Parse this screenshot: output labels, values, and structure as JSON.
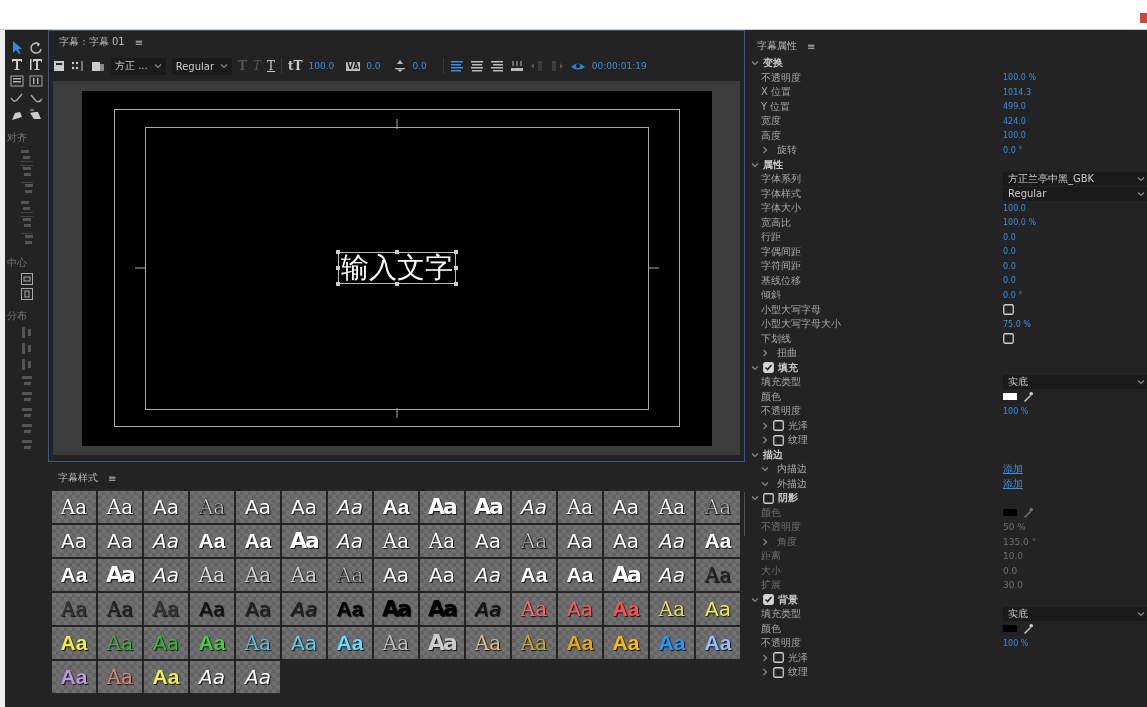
{
  "left_toolbar": {
    "sections": [
      {
        "label": "对齐"
      },
      {
        "label": "中心"
      },
      {
        "label": "分布"
      }
    ]
  },
  "titler": {
    "title": "字幕 : 字幕 01",
    "menu": "≡",
    "toolbar": {
      "font": "方正 ...",
      "style": "Regular",
      "style_buttons": [
        {
          "glyph": "T",
          "disabled": true
        },
        {
          "glyph": "T",
          "disabled": true
        },
        {
          "glyph": "T",
          "disabled": false
        }
      ],
      "size_glyph": "tT",
      "font_size": "100.0",
      "kerning_glyph": "VA",
      "kerning": "0.0",
      "baseline": "0.0",
      "alignments": [
        {
          "selected": true
        },
        {
          "selected": false
        },
        {
          "selected": false
        }
      ],
      "timecode": "00:00:01:19"
    },
    "canvas": {
      "text": "输入文字"
    }
  },
  "styles_panel": {
    "title": "字幕样式",
    "menu": "≡",
    "styles": [
      {
        "text": "Aa",
        "kind": "serif",
        "color": "#ffffff"
      },
      {
        "text": "Aa",
        "kind": "serif",
        "color": "#ffffff"
      },
      {
        "text": "Aa",
        "kind": "sans",
        "color": "#ffffff"
      },
      {
        "text": "Aa",
        "kind": "outline",
        "color": "#dddddd"
      },
      {
        "text": "Aa",
        "kind": "sans",
        "color": "#ffffff"
      },
      {
        "text": "Aa",
        "kind": "sans",
        "color": "#ffffff"
      },
      {
        "text": "Aa",
        "kind": "italic",
        "color": "#ffffff"
      },
      {
        "text": "Aa",
        "kind": "bold",
        "color": "#ffffff"
      },
      {
        "text": "Aa",
        "kind": "heavy",
        "color": "#ffffff"
      },
      {
        "text": "Aa",
        "kind": "heavy",
        "color": "#ffffff"
      },
      {
        "text": "Aa",
        "kind": "italic",
        "color": "#ffffff"
      },
      {
        "text": "Aa",
        "kind": "serif",
        "color": "#ffffff"
      },
      {
        "text": "Aa",
        "kind": "sans",
        "color": "#ffffff"
      },
      {
        "text": "Aa",
        "kind": "serif",
        "color": "#ffffff"
      },
      {
        "text": "Aa",
        "kind": "outline",
        "color": "#dddddd"
      },
      {
        "text": "Aa",
        "kind": "sans",
        "color": "#ffffff"
      },
      {
        "text": "Aa",
        "kind": "sans",
        "color": "#ffffff"
      },
      {
        "text": "Aa",
        "kind": "italic",
        "color": "#ffffff"
      },
      {
        "text": "Aa",
        "kind": "bold",
        "color": "#ffffff"
      },
      {
        "text": "Aa",
        "kind": "bold",
        "color": "#ffffff"
      },
      {
        "text": "Aa",
        "kind": "heavy",
        "color": "#ffffff"
      },
      {
        "text": "Aa",
        "kind": "italic",
        "color": "#ffffff"
      },
      {
        "text": "Aa",
        "kind": "serif",
        "color": "#ffffff"
      },
      {
        "text": "Aa",
        "kind": "serif",
        "color": "#ffffff"
      },
      {
        "text": "Aa",
        "kind": "sans",
        "color": "#ffffff"
      },
      {
        "text": "Aa",
        "kind": "outline",
        "color": "#dddddd"
      },
      {
        "text": "Aa",
        "kind": "sans",
        "color": "#ffffff"
      },
      {
        "text": "Aa",
        "kind": "sans",
        "color": "#ffffff"
      },
      {
        "text": "Aa",
        "kind": "italic",
        "color": "#ffffff"
      },
      {
        "text": "Aa",
        "kind": "bold",
        "color": "#ffffff"
      },
      {
        "text": "Aa",
        "kind": "bold",
        "color": "#ffffff"
      },
      {
        "text": "Aa",
        "kind": "heavy",
        "color": "#ffffff"
      },
      {
        "text": "Aa",
        "kind": "italic",
        "color": "#ffffff"
      },
      {
        "text": "Aa",
        "kind": "serif",
        "color": "#dddddd"
      },
      {
        "text": "Aa",
        "kind": "serif",
        "color": "#cccccc"
      },
      {
        "text": "Aa",
        "kind": "serif",
        "color": "#cccccc"
      },
      {
        "text": "Aa",
        "kind": "outline",
        "color": "#cccccc"
      },
      {
        "text": "Aa",
        "kind": "sans",
        "color": "#ffffff"
      },
      {
        "text": "Aa",
        "kind": "sans",
        "color": "#ffffff"
      },
      {
        "text": "Aa",
        "kind": "italic",
        "color": "#ffffff"
      },
      {
        "text": "Aa",
        "kind": "bold",
        "color": "#ffffff"
      },
      {
        "text": "Aa",
        "kind": "bold",
        "color": "#ffffff"
      },
      {
        "text": "Aa",
        "kind": "heavy",
        "color": "#ffffff"
      },
      {
        "text": "Aa",
        "kind": "italic",
        "color": "#ffffff"
      },
      {
        "text": "Aa",
        "kind": "serif",
        "color": "#222222"
      },
      {
        "text": "Aa",
        "kind": "serif",
        "color": "#333333"
      },
      {
        "text": "Aa",
        "kind": "serif",
        "color": "#222222"
      },
      {
        "text": "Aa",
        "kind": "outline",
        "color": "#333333"
      },
      {
        "text": "Aa",
        "kind": "sans",
        "color": "#111111"
      },
      {
        "text": "Aa",
        "kind": "sans",
        "color": "#222222"
      },
      {
        "text": "Aa",
        "kind": "italic",
        "color": "#222222"
      },
      {
        "text": "Aa",
        "kind": "bold",
        "color": "#000000"
      },
      {
        "text": "Aa",
        "kind": "heavy",
        "color": "#000000"
      },
      {
        "text": "Aa",
        "kind": "heavy",
        "color": "#000000"
      },
      {
        "text": "Aa",
        "kind": "italic",
        "color": "#111111"
      },
      {
        "text": "Aa",
        "kind": "serif",
        "color": "#ff6666"
      },
      {
        "text": "Aa",
        "kind": "sans",
        "color": "#ff5a5a"
      },
      {
        "text": "Aa",
        "kind": "bold",
        "color": "#ff5050"
      },
      {
        "text": "Aa",
        "kind": "serif",
        "color": "#dddd66"
      },
      {
        "text": "Aa",
        "kind": "sans",
        "color": "#eeee55"
      },
      {
        "text": "Aa",
        "kind": "bold",
        "color": "#eeee44"
      },
      {
        "text": "Aa",
        "kind": "serif",
        "color": "#44aa44"
      },
      {
        "text": "Aa",
        "kind": "sans",
        "color": "#33bb33"
      },
      {
        "text": "Aa",
        "kind": "bold",
        "color": "#44cc44"
      },
      {
        "text": "Aa",
        "kind": "serif",
        "color": "#66bbdd"
      },
      {
        "text": "Aa",
        "kind": "sans",
        "color": "#66ccee"
      },
      {
        "text": "Aa",
        "kind": "bold",
        "color": "#66ddff"
      },
      {
        "text": "Aa",
        "kind": "serif",
        "color": "#bbbbbb"
      },
      {
        "text": "Aa",
        "kind": "heavy",
        "color": "#cccccc"
      },
      {
        "text": "Aa",
        "kind": "serif",
        "color": "#ddbb88"
      },
      {
        "text": "Aa",
        "kind": "serif",
        "color": "#ccaa33"
      },
      {
        "text": "Aa",
        "kind": "bold",
        "color": "#ddaa11"
      },
      {
        "text": "Aa",
        "kind": "bold",
        "color": "#ffbb00"
      },
      {
        "text": "Aa",
        "kind": "bold",
        "color": "#2299ff"
      },
      {
        "text": "Aa",
        "kind": "bold",
        "color": "#99bbff"
      },
      {
        "text": "Aa",
        "kind": "bold",
        "color": "#bb99dd"
      },
      {
        "text": "Aa",
        "kind": "serif",
        "color": "#dd8877"
      },
      {
        "text": "Aa",
        "kind": "bold",
        "color": "#eeee55"
      },
      {
        "text": "Aa",
        "kind": "italic",
        "color": "#ffffff"
      },
      {
        "text": "Aa",
        "kind": "italic",
        "color": "#ffffff"
      }
    ]
  },
  "properties": {
    "title": "字幕属性",
    "menu": "≡",
    "rows": [
      {
        "kind": "section",
        "label": "变换",
        "expanded": true
      },
      {
        "kind": "value",
        "label": "不透明度",
        "value": "100.0 %"
      },
      {
        "kind": "value",
        "label": "X 位置",
        "value": "1014.3"
      },
      {
        "kind": "value",
        "label": "Y 位置",
        "value": "499.0"
      },
      {
        "kind": "value",
        "label": "宽度",
        "value": "424.0"
      },
      {
        "kind": "value",
        "label": "高度",
        "value": "100.0"
      },
      {
        "kind": "group",
        "label": "旋转",
        "expanded": false,
        "value": "0.0 °"
      },
      {
        "kind": "section",
        "label": "属性",
        "expanded": true
      },
      {
        "kind": "dropdown",
        "label": "字体系列",
        "value": "方正兰亭中黑_GBK"
      },
      {
        "kind": "dropdown",
        "label": "字体样式",
        "value": "Regular"
      },
      {
        "kind": "value",
        "label": "字体大小",
        "value": "100.0"
      },
      {
        "kind": "value",
        "label": "宽高比",
        "value": "100.0 %"
      },
      {
        "kind": "value",
        "label": "行距",
        "value": "0.0"
      },
      {
        "kind": "value",
        "label": "字偶间距",
        "value": "0.0"
      },
      {
        "kind": "value",
        "label": "字符间距",
        "value": "0.0"
      },
      {
        "kind": "value",
        "label": "基线位移",
        "value": "0.0"
      },
      {
        "kind": "value",
        "label": "倾斜",
        "value": "0.0 °"
      },
      {
        "kind": "checkbox",
        "label": "小型大写字母",
        "checked": false
      },
      {
        "kind": "value",
        "label": "小型大写字母大小",
        "value": "75.0 %"
      },
      {
        "kind": "checkbox",
        "label": "下划线",
        "checked": false
      },
      {
        "kind": "group",
        "label": "扭曲",
        "expanded": false
      },
      {
        "kind": "section",
        "label": "填充",
        "expanded": true,
        "checked": true
      },
      {
        "kind": "dropdown",
        "label": "填充类型",
        "value": "实底"
      },
      {
        "kind": "color",
        "label": "颜色",
        "color": "#ffffff"
      },
      {
        "kind": "value",
        "label": "不透明度",
        "value": "100 %"
      },
      {
        "kind": "group",
        "label": "光泽",
        "expanded": false,
        "checked": false
      },
      {
        "kind": "group",
        "label": "纹理",
        "expanded": false,
        "checked": false
      },
      {
        "kind": "section",
        "label": "描边",
        "expanded": true
      },
      {
        "kind": "group",
        "label": "内描边",
        "expanded": true,
        "link": "添加"
      },
      {
        "kind": "group",
        "label": "外描边",
        "expanded": true,
        "link": "添加"
      },
      {
        "kind": "section",
        "label": "阴影",
        "expanded": true,
        "checked": false
      },
      {
        "kind": "color",
        "label": "颜色",
        "color": "#000000",
        "disabled": true
      },
      {
        "kind": "value",
        "label": "不透明度",
        "value": "50 %",
        "disabled": true
      },
      {
        "kind": "group",
        "label": "角度",
        "expanded": false,
        "value": "135.0 °",
        "disabled": true
      },
      {
        "kind": "value",
        "label": "距离",
        "value": "10.0",
        "disabled": true
      },
      {
        "kind": "value",
        "label": "大小",
        "value": "0.0",
        "disabled": true
      },
      {
        "kind": "value",
        "label": "扩展",
        "value": "30.0",
        "disabled": true
      },
      {
        "kind": "section",
        "label": "背景",
        "expanded": true,
        "checked": true
      },
      {
        "kind": "dropdown",
        "label": "填充类型",
        "value": "实底"
      },
      {
        "kind": "color",
        "label": "颜色",
        "color": "#000000"
      },
      {
        "kind": "value",
        "label": "不透明度",
        "value": "100 %"
      },
      {
        "kind": "group",
        "label": "光泽",
        "expanded": false,
        "checked": false
      },
      {
        "kind": "group",
        "label": "纹理",
        "expanded": false,
        "checked": false
      }
    ]
  }
}
